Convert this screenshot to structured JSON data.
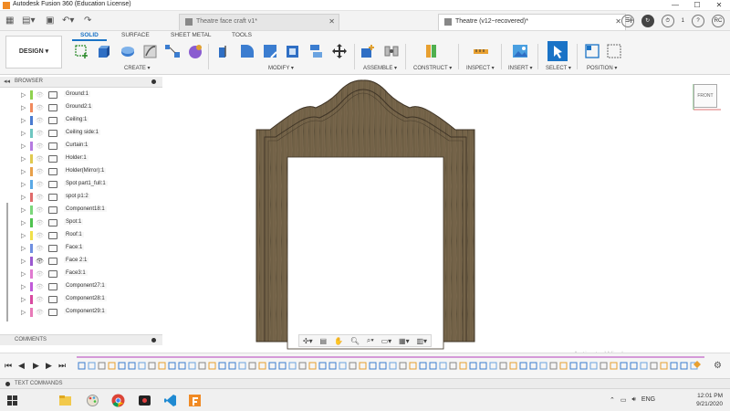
{
  "window": {
    "title": "Autodesk Fusion 360 (Education License)",
    "controls": [
      "—",
      "☐",
      "✕"
    ]
  },
  "tabs": {
    "items": [
      {
        "label": "Theatre face craft v1*",
        "active": false
      },
      {
        "label": "Theatre (v12~recovered)*",
        "active": true
      }
    ],
    "add_label": "+",
    "notification_count": "1",
    "user_initials": "RC",
    "help_label": "?"
  },
  "ribbon": {
    "workspace": "DESIGN ▾",
    "tabs": [
      "SOLID",
      "SURFACE",
      "SHEET METAL",
      "TOOLS"
    ],
    "active_tab": "SOLID",
    "groups": [
      "CREATE ▾",
      "MODIFY ▾",
      "ASSEMBLE ▾",
      "CONSTRUCT ▾",
      "INSPECT ▾",
      "INSERT ▾",
      "SELECT ▾",
      "POSITION ▾"
    ]
  },
  "browser": {
    "title": "BROWSER",
    "items": [
      {
        "name": "Ground:1",
        "color": "#8fd14f",
        "visible": false
      },
      {
        "name": "Ground2:1",
        "color": "#f08a5d",
        "visible": false
      },
      {
        "name": "Ceiling:1",
        "color": "#4a7bd0",
        "visible": false
      },
      {
        "name": "Ceiling side:1",
        "color": "#6ec6c0",
        "visible": false
      },
      {
        "name": "Curtain:1",
        "color": "#b57be0",
        "visible": false
      },
      {
        "name": "Holder:1",
        "color": "#e0c94f",
        "visible": false
      },
      {
        "name": "Holder(Mirror):1",
        "color": "#e8a04a",
        "visible": false
      },
      {
        "name": "Spot part1_full:1",
        "color": "#5aa9e6",
        "visible": false
      },
      {
        "name": "spot p1:2",
        "color": "#e06b6b",
        "visible": false
      },
      {
        "name": "Component18:1",
        "color": "#7bd67b",
        "visible": false
      },
      {
        "name": "Spot:1",
        "color": "#4fc24f",
        "visible": false
      },
      {
        "name": "Roof:1",
        "color": "#f0e04a",
        "visible": false
      },
      {
        "name": "Face:1",
        "color": "#6f8fe0",
        "visible": false
      },
      {
        "name": "Face 2:1",
        "color": "#9b59d0",
        "visible": true
      },
      {
        "name": "Face3:1",
        "color": "#e07ad0",
        "visible": false
      },
      {
        "name": "Component27:1",
        "color": "#c05ad8",
        "visible": false
      },
      {
        "name": "Component28:1",
        "color": "#d84aa0",
        "visible": false
      },
      {
        "name": "Component29:1",
        "color": "#e87ab8",
        "visible": false
      }
    ]
  },
  "viewcube": {
    "label": "FRONT"
  },
  "comments": {
    "title": "COMMENTS"
  },
  "text_commands": {
    "title": "TEXT COMMANDS"
  },
  "watermark": {
    "text": "Activate Windows"
  },
  "taskbar": {
    "language": "ENG",
    "time": "12:01 PM",
    "date": "9/21/2020"
  }
}
